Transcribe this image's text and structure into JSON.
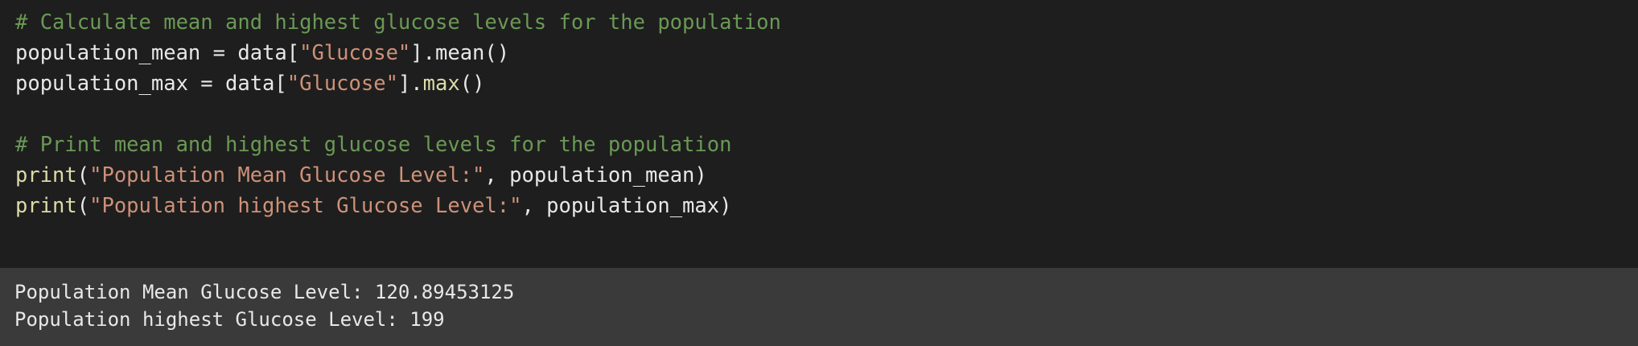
{
  "code": {
    "line1": {
      "comment": "# Calculate mean and highest glucose levels for the population"
    },
    "line2": {
      "a": "population_mean = data[",
      "s": "\"Glucose\"",
      "b": "].mean()"
    },
    "line3": {
      "a": "population_max = data[",
      "s": "\"Glucose\"",
      "b": "].",
      "f": "max",
      "c": "()"
    },
    "line5": {
      "comment": "# Print mean and highest glucose levels for the population"
    },
    "line6": {
      "f": "print",
      "a": "(",
      "s": "\"Population Mean Glucose Level:\"",
      "b": ", population_mean)"
    },
    "line7": {
      "f": "print",
      "a": "(",
      "s": "\"Population highest Glucose Level:\"",
      "b": ", population_max)"
    }
  },
  "output": {
    "lines": [
      "Population Mean Glucose Level: 120.89453125",
      "Population highest Glucose Level: 199"
    ]
  },
  "colors": {
    "background": "#1e1e1e",
    "output_background": "#3a3a3a",
    "comment": "#6a9955",
    "string": "#ce9178",
    "function": "#dcdcaa",
    "text": "#e8e8e8"
  }
}
